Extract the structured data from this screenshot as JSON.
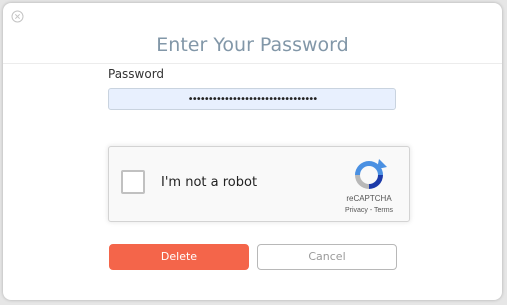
{
  "dialog": {
    "title": "Enter Your Password",
    "close_icon": "circle-x-icon"
  },
  "password": {
    "label": "Password",
    "value": "••••••••••••••••••••••••••••••••"
  },
  "recaptcha": {
    "checkbox_label": "I'm not a robot",
    "checked": false,
    "brand": "reCAPTCHA",
    "privacy_link": "Privacy",
    "separator": " - ",
    "terms_link": "Terms",
    "logo_icon": "recaptcha-logo-icon"
  },
  "actions": {
    "delete_label": "Delete",
    "cancel_label": "Cancel"
  },
  "colors": {
    "title": "#8297a8",
    "delete_bg": "#f4654a",
    "input_bg": "#e8f0fe"
  }
}
